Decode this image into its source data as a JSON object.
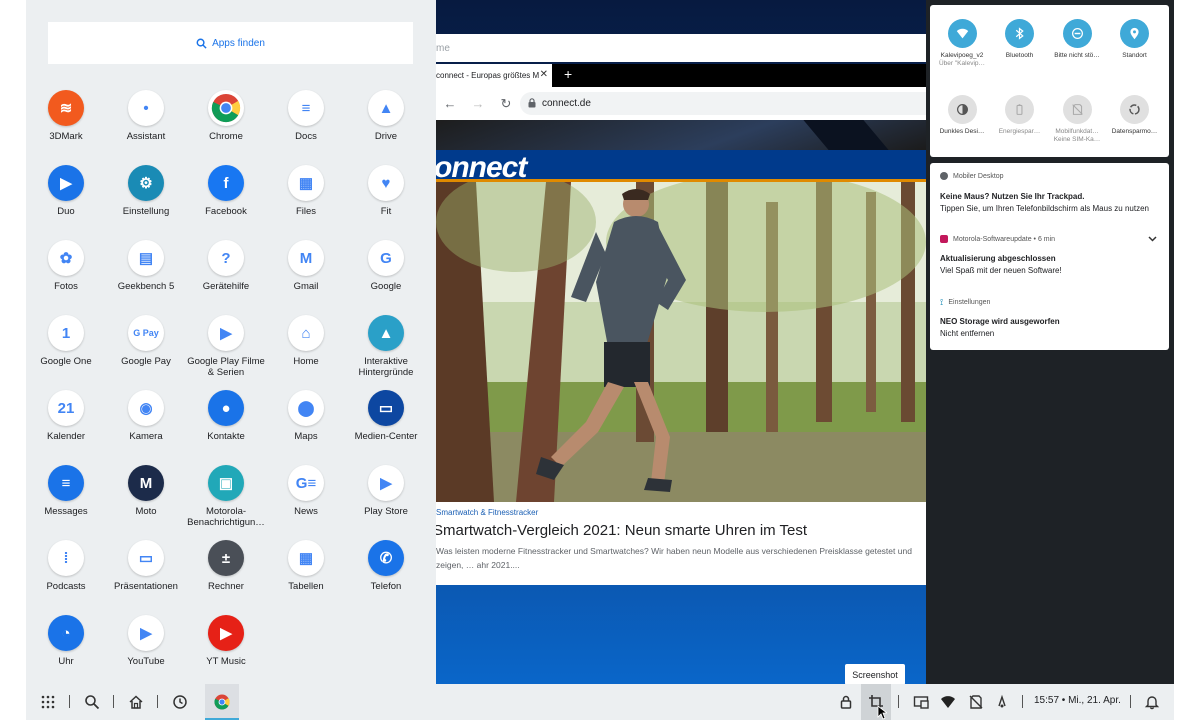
{
  "drawer": {
    "search_label": "Apps finden",
    "apps": [
      {
        "label": "3DMark",
        "icon": "3dmark-icon",
        "color": "#f25a1e",
        "glyph": "≋"
      },
      {
        "label": "Assistant",
        "icon": "assistant-icon",
        "color": "#ffffff",
        "glyph": "•"
      },
      {
        "label": "Chrome",
        "icon": "chrome-icon",
        "color": "#ffffff",
        "glyph": ""
      },
      {
        "label": "Docs",
        "icon": "docs-icon",
        "color": "#ffffff",
        "glyph": "≡"
      },
      {
        "label": "Drive",
        "icon": "drive-icon",
        "color": "#ffffff",
        "glyph": "▲"
      },
      {
        "label": "Duo",
        "icon": "duo-icon",
        "color": "#1a73e8",
        "glyph": "▶"
      },
      {
        "label": "Einstellung",
        "icon": "settings-icon",
        "color": "#1a8bb5",
        "glyph": "⚙"
      },
      {
        "label": "Facebook",
        "icon": "facebook-icon",
        "color": "#1877f2",
        "glyph": "f"
      },
      {
        "label": "Files",
        "icon": "files-icon",
        "color": "#ffffff",
        "glyph": "▦"
      },
      {
        "label": "Fit",
        "icon": "fit-icon",
        "color": "#ffffff",
        "glyph": "♥"
      },
      {
        "label": "Fotos",
        "icon": "photos-icon",
        "color": "#ffffff",
        "glyph": "✿"
      },
      {
        "label": "Geekbench 5",
        "icon": "geekbench-icon",
        "color": "#ffffff",
        "glyph": "▤"
      },
      {
        "label": "Gerätehilfe",
        "icon": "help-icon",
        "color": "#ffffff",
        "glyph": "?"
      },
      {
        "label": "Gmail",
        "icon": "gmail-icon",
        "color": "#ffffff",
        "glyph": "M"
      },
      {
        "label": "Google",
        "icon": "google-icon",
        "color": "#ffffff",
        "glyph": "G"
      },
      {
        "label": "Google One",
        "icon": "google-one-icon",
        "color": "#ffffff",
        "glyph": "1"
      },
      {
        "label": "Google Pay",
        "icon": "google-pay-icon",
        "color": "#ffffff",
        "glyph": "G Pay"
      },
      {
        "label": "Google Play Filme & Serien",
        "icon": "play-movies-icon",
        "color": "#ffffff",
        "glyph": "▶"
      },
      {
        "label": "Home",
        "icon": "home-app-icon",
        "color": "#ffffff",
        "glyph": "⌂"
      },
      {
        "label": "Interaktive Hintergründe",
        "icon": "live-wallpaper-icon",
        "color": "#2aa0c8",
        "glyph": "▲"
      },
      {
        "label": "Kalender",
        "icon": "calendar-icon",
        "color": "#ffffff",
        "glyph": "21"
      },
      {
        "label": "Kamera",
        "icon": "camera-icon",
        "color": "#ffffff",
        "glyph": "◉"
      },
      {
        "label": "Kontakte",
        "icon": "contacts-icon",
        "color": "#1a73e8",
        "glyph": "●"
      },
      {
        "label": "Maps",
        "icon": "maps-icon",
        "color": "#ffffff",
        "glyph": "⬤"
      },
      {
        "label": "Medien-Center",
        "icon": "media-center-icon",
        "color": "#0d47a1",
        "glyph": "▭"
      },
      {
        "label": "Messages",
        "icon": "messages-icon",
        "color": "#1a73e8",
        "glyph": "≡"
      },
      {
        "label": "Moto",
        "icon": "moto-icon",
        "color": "#1c2b4a",
        "glyph": "M"
      },
      {
        "label": "Motorola-Benachrichtigun…",
        "icon": "motorola-notifications-icon",
        "color": "#21a8b8",
        "glyph": "▣"
      },
      {
        "label": "News",
        "icon": "news-icon",
        "color": "#ffffff",
        "glyph": "G≡"
      },
      {
        "label": "Play Store",
        "icon": "play-store-icon",
        "color": "#ffffff",
        "glyph": "▶"
      },
      {
        "label": "Podcasts",
        "icon": "podcasts-icon",
        "color": "#ffffff",
        "glyph": "⁞"
      },
      {
        "label": "Präsentationen",
        "icon": "slides-icon",
        "color": "#ffffff",
        "glyph": "▭"
      },
      {
        "label": "Rechner",
        "icon": "calculator-icon",
        "color": "#4a4f57",
        "glyph": "±"
      },
      {
        "label": "Tabellen",
        "icon": "sheets-icon",
        "color": "#ffffff",
        "glyph": "▦"
      },
      {
        "label": "Telefon",
        "icon": "phone-icon",
        "color": "#1a73e8",
        "glyph": "✆"
      },
      {
        "label": "Uhr",
        "icon": "clock-icon",
        "color": "#1a73e8",
        "glyph": "◔"
      },
      {
        "label": "YouTube",
        "icon": "youtube-icon",
        "color": "#ffffff",
        "glyph": "▶"
      },
      {
        "label": "YT Music",
        "icon": "yt-music-icon",
        "color": "#e62117",
        "glyph": "▶"
      }
    ]
  },
  "browser": {
    "omnibox_partial": "me",
    "tab_title": "connect - Europas größtes M",
    "url": "connect.de",
    "brand": "onnect",
    "article_category": "Smartwatch & Fitnesstracker",
    "article_title": "Smartwatch-Vergleich 2021: Neun smarte Uhren im Test",
    "article_desc": "Was leisten moderne Fitnesstracker und Smartwatches? Wir haben neun Modelle aus verschiedenen Preisklasse getestet und zeigen, … ahr 2021...."
  },
  "tooltip": "Screenshot",
  "quick_settings": [
    {
      "label": "Kalevipoeg_v2",
      "sub": "Über \"Kalevip…",
      "icon": "wifi-icon",
      "state": "on"
    },
    {
      "label": "Bluetooth",
      "sub": "",
      "icon": "bluetooth-icon",
      "state": "on"
    },
    {
      "label": "Bitte nicht stö…",
      "sub": "",
      "icon": "dnd-icon",
      "state": "on"
    },
    {
      "label": "Standort",
      "sub": "",
      "icon": "location-icon",
      "state": "on"
    },
    {
      "label": "Dunkles Desi…",
      "sub": "",
      "icon": "dark-theme-icon",
      "state": "off"
    },
    {
      "label": "Energiespar…",
      "sub": "",
      "icon": "battery-saver-icon",
      "state": "disabled"
    },
    {
      "label": "Mobilfunkdat…",
      "sub": "Keine SIM-Ka…",
      "icon": "mobile-data-icon",
      "state": "disabled"
    },
    {
      "label": "Datensparmo…",
      "sub": "",
      "icon": "data-saver-icon",
      "state": "off"
    }
  ],
  "notifications": {
    "n1_app": "Mobiler Desktop",
    "n1_title": "Keine Maus? Nutzen Sie Ihr Trackpad.",
    "n1_text": "Tippen Sie, um Ihren Telefonbildschirm als Maus zu nutzen",
    "n2_app": "Motorola-Softwareupdate • 6 min",
    "n2_title": "Aktualisierung abgeschlossen",
    "n2_text": "Viel Spaß mit der neuen Software!",
    "n3_app": "Einstellungen",
    "n3_title": "NEO Storage wird ausgeworfen",
    "n3_text": "Nicht entfernen"
  },
  "taskbar": {
    "clock": "15:57 • Mi., 21. Apr."
  }
}
